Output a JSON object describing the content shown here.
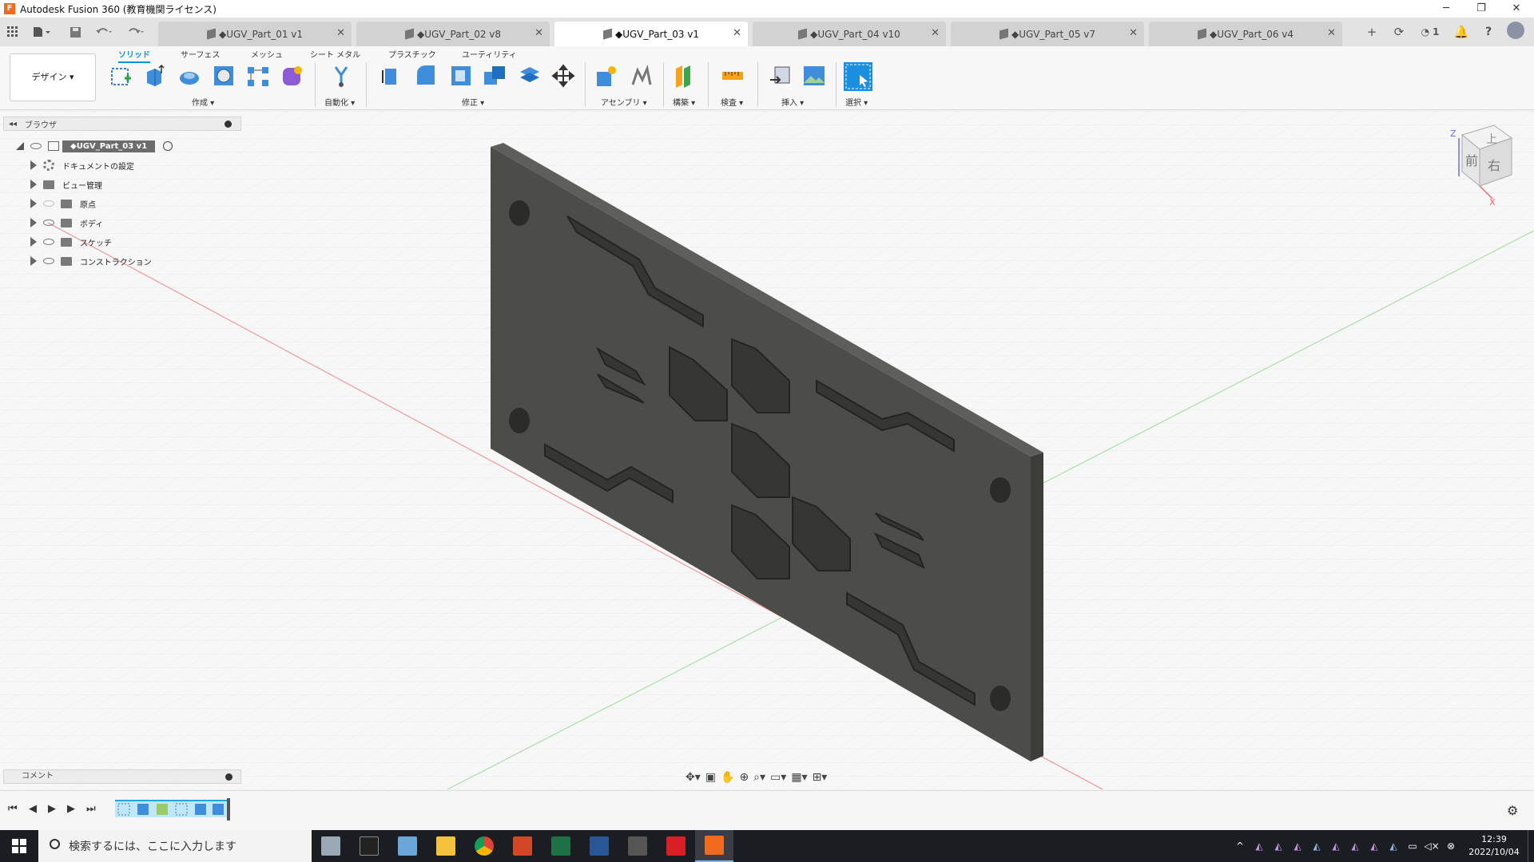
{
  "window": {
    "title": "Autodesk Fusion 360 (教育機関ライセンス)",
    "controls": [
      "─",
      "❐",
      "✕"
    ]
  },
  "tabs": [
    {
      "label": "◆UGV_Part_01 v1"
    },
    {
      "label": "◆UGV_Part_02 v8"
    },
    {
      "label": "◆UGV_Part_03 v1",
      "active": true
    },
    {
      "label": "◆UGV_Part_04 v10"
    },
    {
      "label": "◆UGV_Part_05 v7"
    },
    {
      "label": "◆UGV_Part_06 v4"
    }
  ],
  "tab_close": "✕",
  "top_right": {
    "add": "+",
    "online_count": "1"
  },
  "ribbon": {
    "tabs": [
      "ソリッド",
      "サーフェス",
      "メッシュ",
      "シート メタル",
      "プラスチック",
      "ユーティリティ"
    ],
    "workspace": "デザイン ▾",
    "groups": {
      "create": "作成 ▾",
      "automate": "自動化 ▾",
      "modify": "修正 ▾",
      "assemble": "アセンブリ ▾",
      "construct": "構築 ▾",
      "inspect": "検査 ▾",
      "insert": "挿入 ▾",
      "select": "選択 ▾"
    }
  },
  "browser": {
    "title": "ブラウザ",
    "root": "◆UGV_Part_03 v1",
    "items": [
      "ドキュメントの設定",
      "ビュー管理",
      "原点",
      "ボディ",
      "スケッチ",
      "コンストラクション"
    ]
  },
  "comments": {
    "label": "コメント"
  },
  "viewcube": {
    "top": "上",
    "front": "前",
    "right": "右",
    "axis_z": "Z",
    "axis_x": "X"
  },
  "taskbar": {
    "search_placeholder": "検索するには、ここに入力します",
    "clock_time": "12:39",
    "clock_date": "2022/10/04"
  },
  "colors": {
    "accent": "#0696d7",
    "part": "#4c4c48",
    "grid": "#e5e5e5",
    "fusion_orange": "#f26b1d"
  }
}
